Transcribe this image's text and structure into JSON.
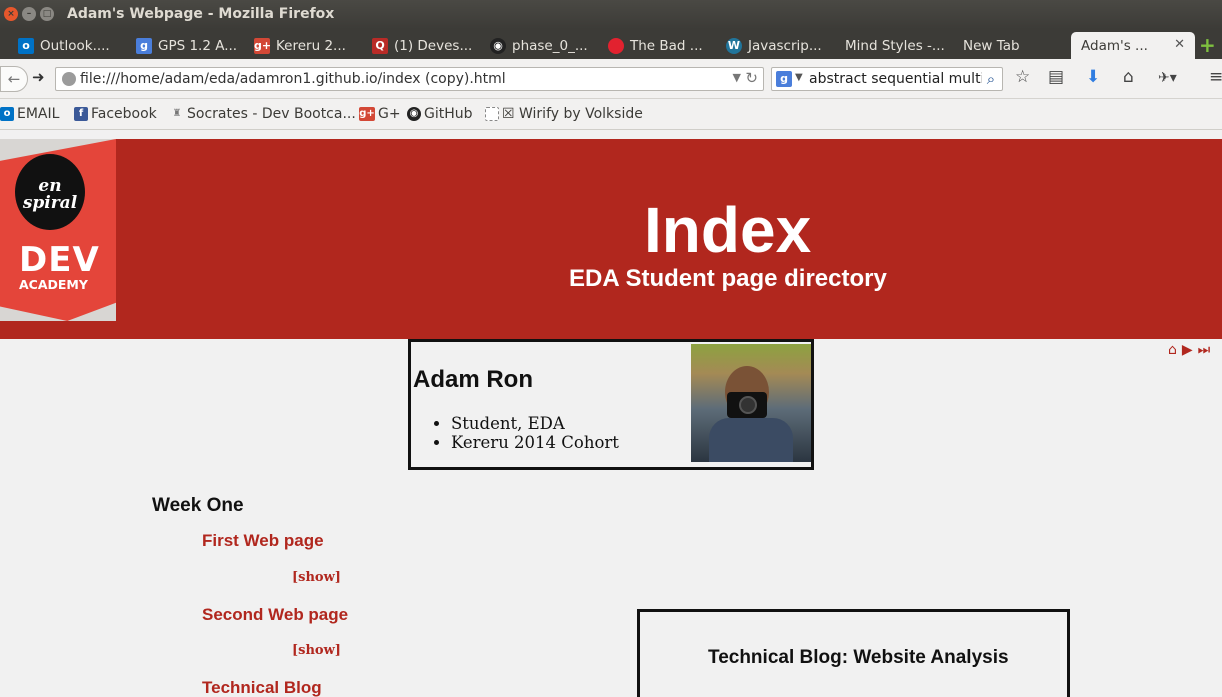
{
  "window": {
    "title": "Adam's Webpage - Mozilla Firefox"
  },
  "tabs": [
    {
      "label": "Outlook....",
      "icon": "outlook-icon",
      "color": "#0072c6"
    },
    {
      "label": "GPS 1.2 A...",
      "icon": "google-icon",
      "color": "#4a7edb"
    },
    {
      "label": "Kereru 2...",
      "icon": "google-plus-icon",
      "color": "#d34836"
    },
    {
      "label": "(1) Deves...",
      "icon": "quora-icon",
      "color": "#b92b27"
    },
    {
      "label": "phase_0_...",
      "icon": "github-icon",
      "color": "#222222"
    },
    {
      "label": "The Bad ...",
      "icon": "red-dot-icon",
      "color": "#e2222f"
    },
    {
      "label": "Javascrip...",
      "icon": "wordpress-icon",
      "color": "#21759b"
    },
    {
      "label": "Mind Styles -..."
    },
    {
      "label": "New Tab"
    },
    {
      "label": "Adam's ...",
      "active": true
    }
  ],
  "nav": {
    "url": "file:///home/adam/eda/adamron1.github.io/index (copy).html",
    "search": "abstract sequential multin"
  },
  "bookmarks": [
    {
      "label": "EMAIL",
      "icon": "outlook-icon",
      "color": "#0072c6"
    },
    {
      "label": "Facebook",
      "icon": "facebook-icon",
      "color": "#3b5998"
    },
    {
      "label": "Socrates - Dev Bootca...",
      "icon": "socrates-icon",
      "color": "#777777"
    },
    {
      "label": "G+",
      "icon": "google-plus-icon",
      "color": "#d34836"
    },
    {
      "label": "GitHub",
      "icon": "github-icon",
      "color": "#222222"
    },
    {
      "label": "☒ Wirify by Volkside",
      "icon": "blank-page-icon",
      "color": "#ffffff"
    }
  ],
  "logo": {
    "line1": "en",
    "line2": "spiral",
    "dev": "DEV",
    "academy": "ACADEMY"
  },
  "banner": {
    "title": "Index",
    "subtitle": "EDA Student page directory"
  },
  "profile": {
    "name": "Adam Ron",
    "items": [
      "Student, EDA",
      "Kereru 2014 Cohort"
    ]
  },
  "content": {
    "week_heading": "Week One",
    "links": [
      {
        "label": "First Web page",
        "show": "[show]"
      },
      {
        "label": "Second Web page",
        "show": "[show]"
      },
      {
        "label": "Technical Blog"
      }
    ],
    "blog_title": "Technical Blog: Website Analysis"
  },
  "colors": {
    "accent": "#b1271e",
    "titlebar": "#3c3b37"
  }
}
